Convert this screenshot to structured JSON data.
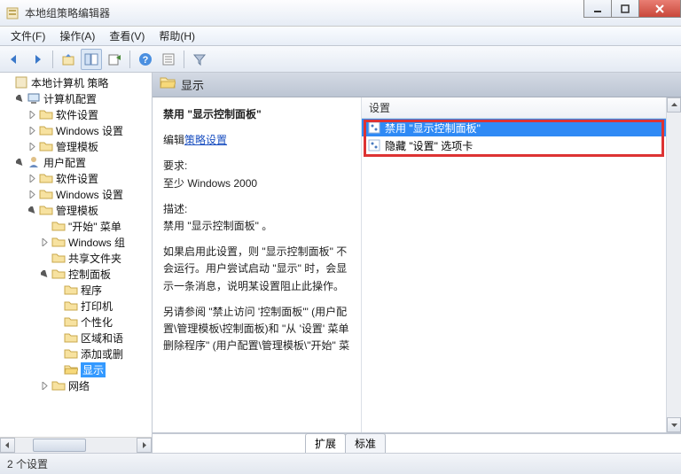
{
  "window": {
    "title": "本地组策略编辑器"
  },
  "menu": {
    "file": "文件(F)",
    "action": "操作(A)",
    "view": "查看(V)",
    "help": "帮助(H)"
  },
  "tree": {
    "root": "本地计算机 策略",
    "computer_config": "计算机配置",
    "cc_software": "软件设置",
    "cc_windows": "Windows 设置",
    "cc_admin": "管理模板",
    "user_config": "用户配置",
    "uc_software": "软件设置",
    "uc_windows": "Windows 设置",
    "uc_admin": "管理模板",
    "start_menu": "\"开始\" 菜单",
    "windows_comp": "Windows 组",
    "shared_folders": "共享文件夹",
    "control_panel": "控制面板",
    "programs": "程序",
    "printers": "打印机",
    "personalization": "个性化",
    "region": "区域和语",
    "add_remove": "添加或删",
    "display": "显示",
    "network": "网络"
  },
  "header": {
    "title": "显示"
  },
  "desc": {
    "policy_title": "禁用 \"显示控制面板\"",
    "edit_prefix": "编辑",
    "edit_link": "策略设置",
    "req_label": "要求:",
    "req_value": "至少 Windows 2000",
    "desc_label": "描述:",
    "desc_line1": "禁用 \"显示控制面板\" 。",
    "desc_para1": "如果启用此设置，则 \"显示控制面板\" 不会运行。用户尝试启动 \"显示\" 时，会显示一条消息，说明某设置阻止此操作。",
    "desc_para2": "另请参阅 \"禁止访问 '控制面板'\" (用户配置\\管理模板\\控制面板)和 \"从 '设置' 菜单删除程序\" (用户配置\\管理模板\\\"开始\" 菜"
  },
  "list": {
    "header": "设置",
    "item1": "禁用 \"显示控制面板\"",
    "item2": "隐藏 \"设置\" 选项卡"
  },
  "tabs": {
    "extended": "扩展",
    "standard": "标准"
  },
  "status": {
    "text": "2 个设置"
  }
}
